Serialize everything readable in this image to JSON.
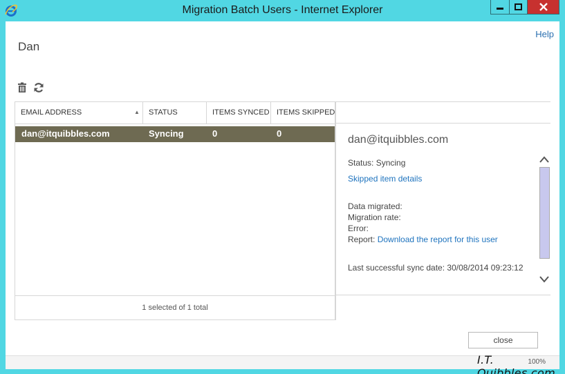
{
  "window": {
    "title": "Migration Batch Users - Internet Explorer",
    "colors": {
      "titlebar": "#51d7e3",
      "close": "#c7312f",
      "selected_row": "#6e6a52",
      "link": "#1e73be"
    }
  },
  "header": {
    "help_label": "Help",
    "user_name": "Dan"
  },
  "toolbar": {
    "icons": [
      "trash-icon",
      "refresh-icon"
    ]
  },
  "table": {
    "columns": [
      "EMAIL ADDRESS",
      "STATUS",
      "ITEMS SYNCED",
      "ITEMS SKIPPED"
    ],
    "rows": [
      {
        "email": "dan@itquibbles.com",
        "status": "Syncing",
        "synced": "0",
        "skipped": "0"
      }
    ],
    "footer": "1 selected of 1 total"
  },
  "details": {
    "email": "dan@itquibbles.com",
    "status_text": "Status: Syncing",
    "skipped_link": "Skipped item details",
    "data_migrated": "Data migrated:",
    "migration_rate": "Migration rate:",
    "error": "Error:",
    "report_label": "Report:",
    "report_link": "Download the report for this user",
    "last_sync": "Last successful sync date: 30/08/2014 09:23:12"
  },
  "footer": {
    "close_label": "close",
    "zoom": "100%"
  },
  "watermark": "I.T. Quibbles.com"
}
